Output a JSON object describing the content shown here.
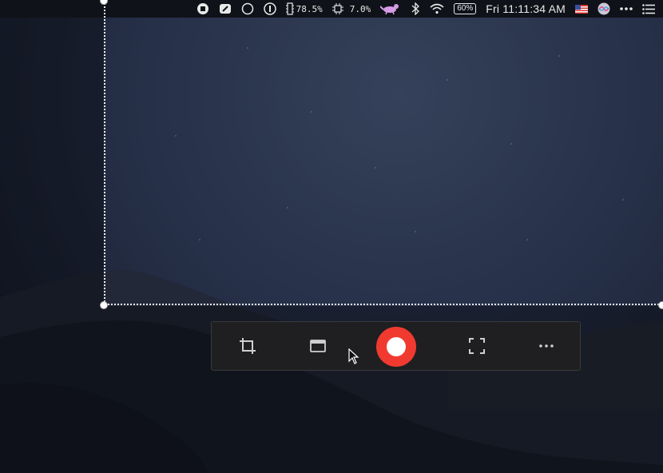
{
  "menubar": {
    "memory_percent": "78.5%",
    "cpu_percent": "7.0%",
    "battery_percent": "60%",
    "clock": "Fri 11:11:34 AM",
    "icons": [
      "stop-record-icon",
      "quick-note-icon",
      "circle-icon",
      "1password-icon",
      "memory-chip-icon",
      "cpu-chip-icon",
      "cat-icon",
      "bluetooth-icon",
      "wifi-icon",
      "battery-icon",
      "us-flag-icon",
      "siri-icon",
      "more-icon",
      "notification-center-icon"
    ]
  },
  "toolbar": {
    "buttons": [
      "crop-icon",
      "window-icon",
      "record-button",
      "fullscreen-icon",
      "more-options-icon"
    ],
    "record_color": "#f03a30"
  },
  "colors": {
    "toolbar_bg": "#1f1f21",
    "menubar_bg": "#0f1218",
    "selection_border": "#f2f2f2"
  }
}
